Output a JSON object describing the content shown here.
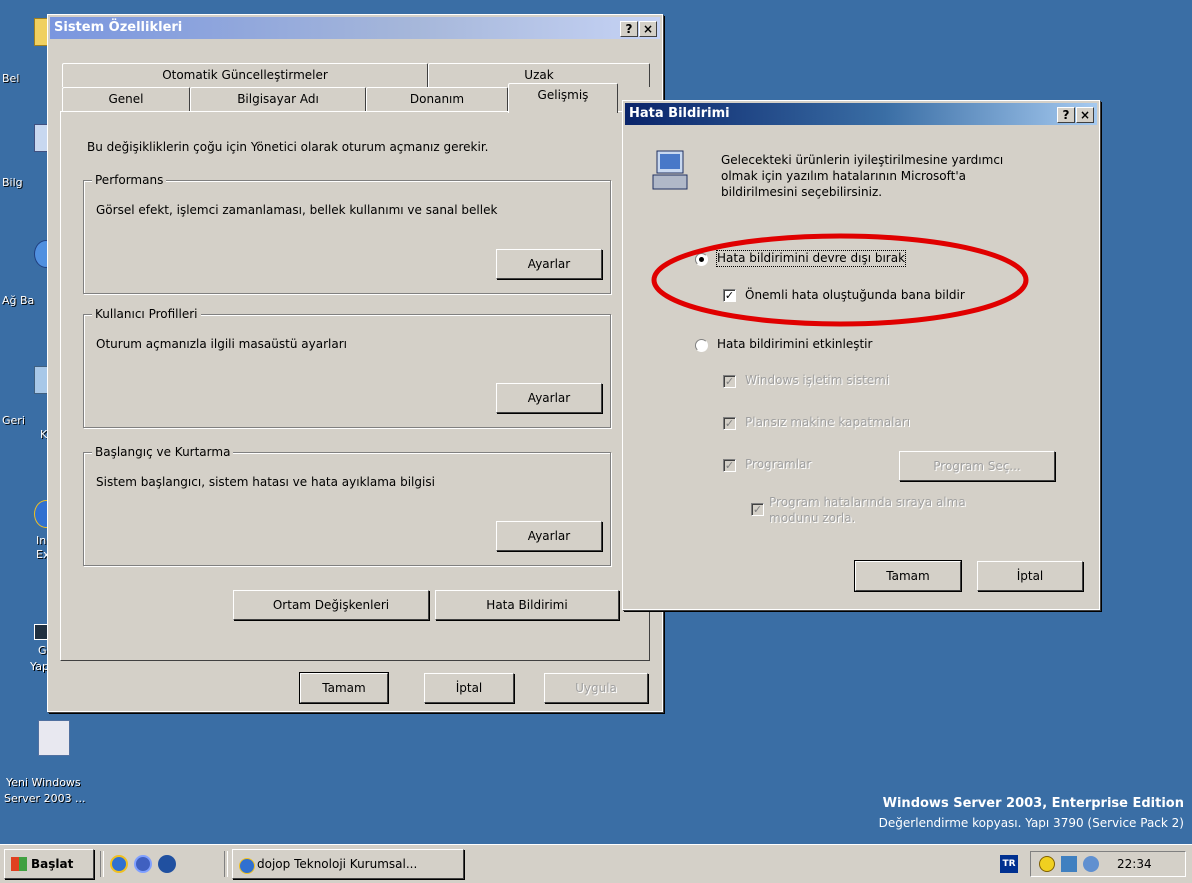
{
  "desktop": {
    "icons": [
      {
        "label": "Bel",
        "icon": "folder-icon"
      },
      {
        "label": "Bilg",
        "icon": "computer-icon"
      },
      {
        "label": "Ağ Ba",
        "icon": "network-icon"
      },
      {
        "label": "Geri",
        "label2": "K",
        "icon": "recycle-bin-icon"
      },
      {
        "label": "In",
        "label2": "Ex",
        "icon": "internet-explorer-icon"
      },
      {
        "label": "Gü",
        "label2": "Yap",
        "icon": "security-shortcut-icon"
      }
    ],
    "setup_icon": {
      "line1": "Yeni Windows",
      "line2": "Server 2003 ..."
    },
    "edition": {
      "line1": "Windows Server 2003, Enterprise Edition",
      "line2": "Değerlendirme kopyası. Yapı 3790 (Service Pack 2)"
    }
  },
  "sysprops": {
    "title": "Sistem Özellikleri",
    "help_glyph": "?",
    "close_glyph": "×",
    "tabs_row1": [
      "Otomatik Güncelleştirmeler",
      "Uzak"
    ],
    "tabs_row2": [
      "Genel",
      "Bilgisayar Adı",
      "Donanım",
      "Gelişmiş"
    ],
    "intro": "Bu değişikliklerin çoğu için Yönetici olarak oturum açmanız gerekir.",
    "groups": [
      {
        "title": "Performans",
        "desc": "Görsel efekt, işlemci zamanlaması, bellek kullanımı ve sanal bellek",
        "button": "Ayarlar"
      },
      {
        "title": "Kullanıcı Profilleri",
        "desc": "Oturum açmanızla ilgili masaüstü ayarları",
        "button": "Ayarlar"
      },
      {
        "title": "Başlangıç ve Kurtarma",
        "desc": "Sistem başlangıcı, sistem hatası ve hata ayıklama bilgisi",
        "button": "Ayarlar"
      }
    ],
    "env_button": "Ortam Değişkenleri",
    "error_button": "Hata Bildirimi",
    "ok": "Tamam",
    "cancel": "İptal",
    "apply": "Uygula"
  },
  "errdlg": {
    "title": "Hata Bildirimi",
    "help_glyph": "?",
    "close_glyph": "×",
    "desc": [
      "Gelecekteki ürünlerin iyileştirilmesine yardımcı",
      "olmak için yazılım hatalarının Microsoft'a",
      "bildirilmesini seçebilirsiniz."
    ],
    "radio_disable": "Hata bildirimini devre dışı bırak",
    "chk_notify": "Önemli hata oluştuğunda bana bildir",
    "radio_enable": "Hata bildirimini etkinleştir",
    "chk_windows": "Windows işletim sistemi",
    "chk_shutdowns": "Plansız makine kapatmaları",
    "chk_programs": "Programlar",
    "select_program": "Program Seç...",
    "chk_queue": [
      "Program hatalarında sıraya alma",
      "modunu zorla."
    ],
    "ok": "Tamam",
    "cancel": "İptal",
    "highlight_color": "#e00000"
  },
  "taskbar": {
    "start": "Başlat",
    "task": "dojop Teknoloji Kurumsal...",
    "lang": "TR",
    "clock": "22:34"
  }
}
